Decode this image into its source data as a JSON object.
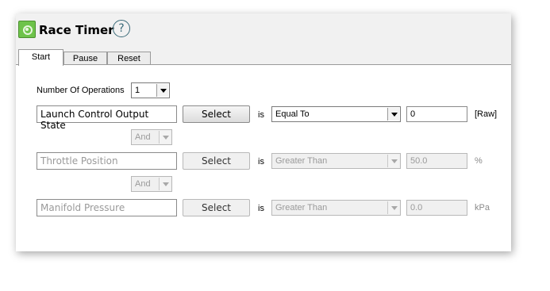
{
  "window": {
    "title": "Race Timer",
    "help_glyph": "?",
    "app_icon": "race-timer-app-icon",
    "help_icon": "help-question-icon"
  },
  "tabs": [
    {
      "label": "Start",
      "active": true
    },
    {
      "label": "Pause",
      "active": false
    },
    {
      "label": "Reset",
      "active": false
    }
  ],
  "operations": {
    "label": "Number Of Operations",
    "value": "1"
  },
  "conditions": [
    {
      "channel": "Launch Control Output State",
      "select_label": "Select",
      "is_label": "is",
      "operator": "Equal To",
      "value": "0",
      "unit": "[Raw]",
      "enabled": true
    },
    {
      "channel": "Throttle Position",
      "select_label": "Select",
      "is_label": "is",
      "operator": "Greater Than",
      "value": "50.0",
      "unit": "%",
      "enabled": false
    },
    {
      "channel": "Manifold Pressure",
      "select_label": "Select",
      "is_label": "is",
      "operator": "Greater Than",
      "value": "0.0",
      "unit": "kPa",
      "enabled": false
    }
  ],
  "connectors": [
    {
      "value": "And"
    },
    {
      "value": "And"
    }
  ]
}
